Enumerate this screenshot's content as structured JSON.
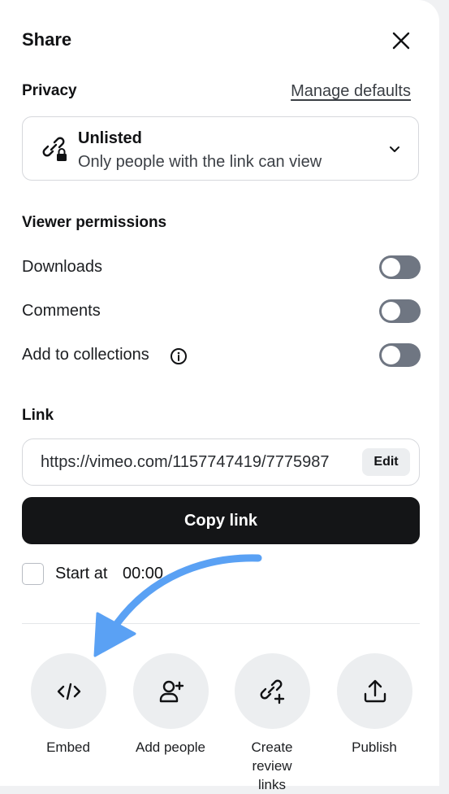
{
  "header": {
    "title": "Share"
  },
  "privacy": {
    "label": "Privacy",
    "manage_link": "Manage defaults",
    "selected": {
      "title": "Unlisted",
      "subtitle": "Only people with the link can view"
    }
  },
  "permissions": {
    "label": "Viewer permissions",
    "items": [
      {
        "label": "Downloads",
        "enabled": false
      },
      {
        "label": "Comments",
        "enabled": false
      },
      {
        "label": "Add to collections",
        "enabled": false
      }
    ]
  },
  "link": {
    "label": "Link",
    "url": "https://vimeo.com/1157747419/7775987",
    "edit_label": "Edit",
    "copy_label": "Copy link",
    "start_at_label": "Start at",
    "start_at_time": "00:00",
    "start_at_checked": false
  },
  "actions": [
    {
      "label": "Embed",
      "icon": "code-icon"
    },
    {
      "label": "Add people",
      "icon": "add-person-icon"
    },
    {
      "label": "Create review links",
      "icon": "link-plus-icon"
    },
    {
      "label": "Publish",
      "icon": "upload-icon"
    }
  ],
  "colors": {
    "toggle_off": "#6f7682",
    "primary_button": "#141517",
    "annotation_arrow": "#5aa1f4"
  }
}
